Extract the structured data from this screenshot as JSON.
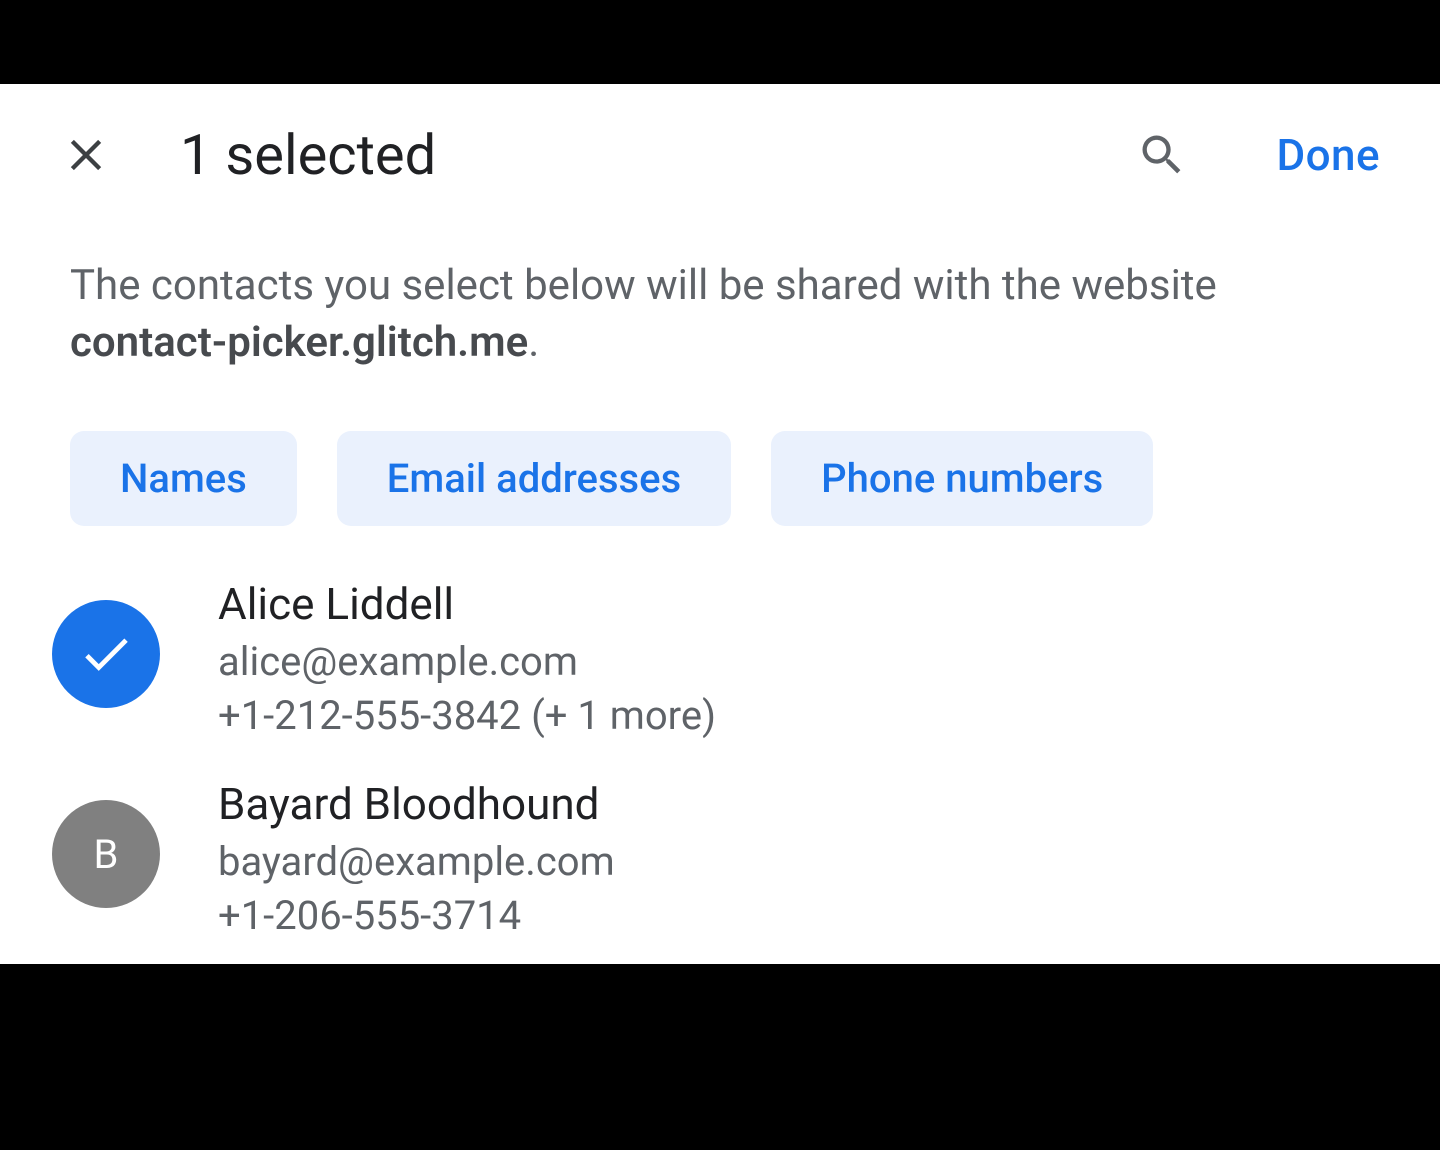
{
  "header": {
    "title": "1 selected",
    "done_label": "Done"
  },
  "explain": {
    "prefix": "The contacts you select below will be shared with the website ",
    "website": "contact-picker.glitch.me",
    "suffix": "."
  },
  "chips": [
    "Names",
    "Email addresses",
    "Phone numbers"
  ],
  "contacts": [
    {
      "selected": true,
      "initial": "",
      "name": "Alice Liddell",
      "email": "alice@example.com",
      "phone": "+1-212-555-3842 (+ 1 more)"
    },
    {
      "selected": false,
      "initial": "B",
      "name": "Bayard Bloodhound",
      "email": "bayard@example.com",
      "phone": "+1-206-555-3714"
    }
  ]
}
